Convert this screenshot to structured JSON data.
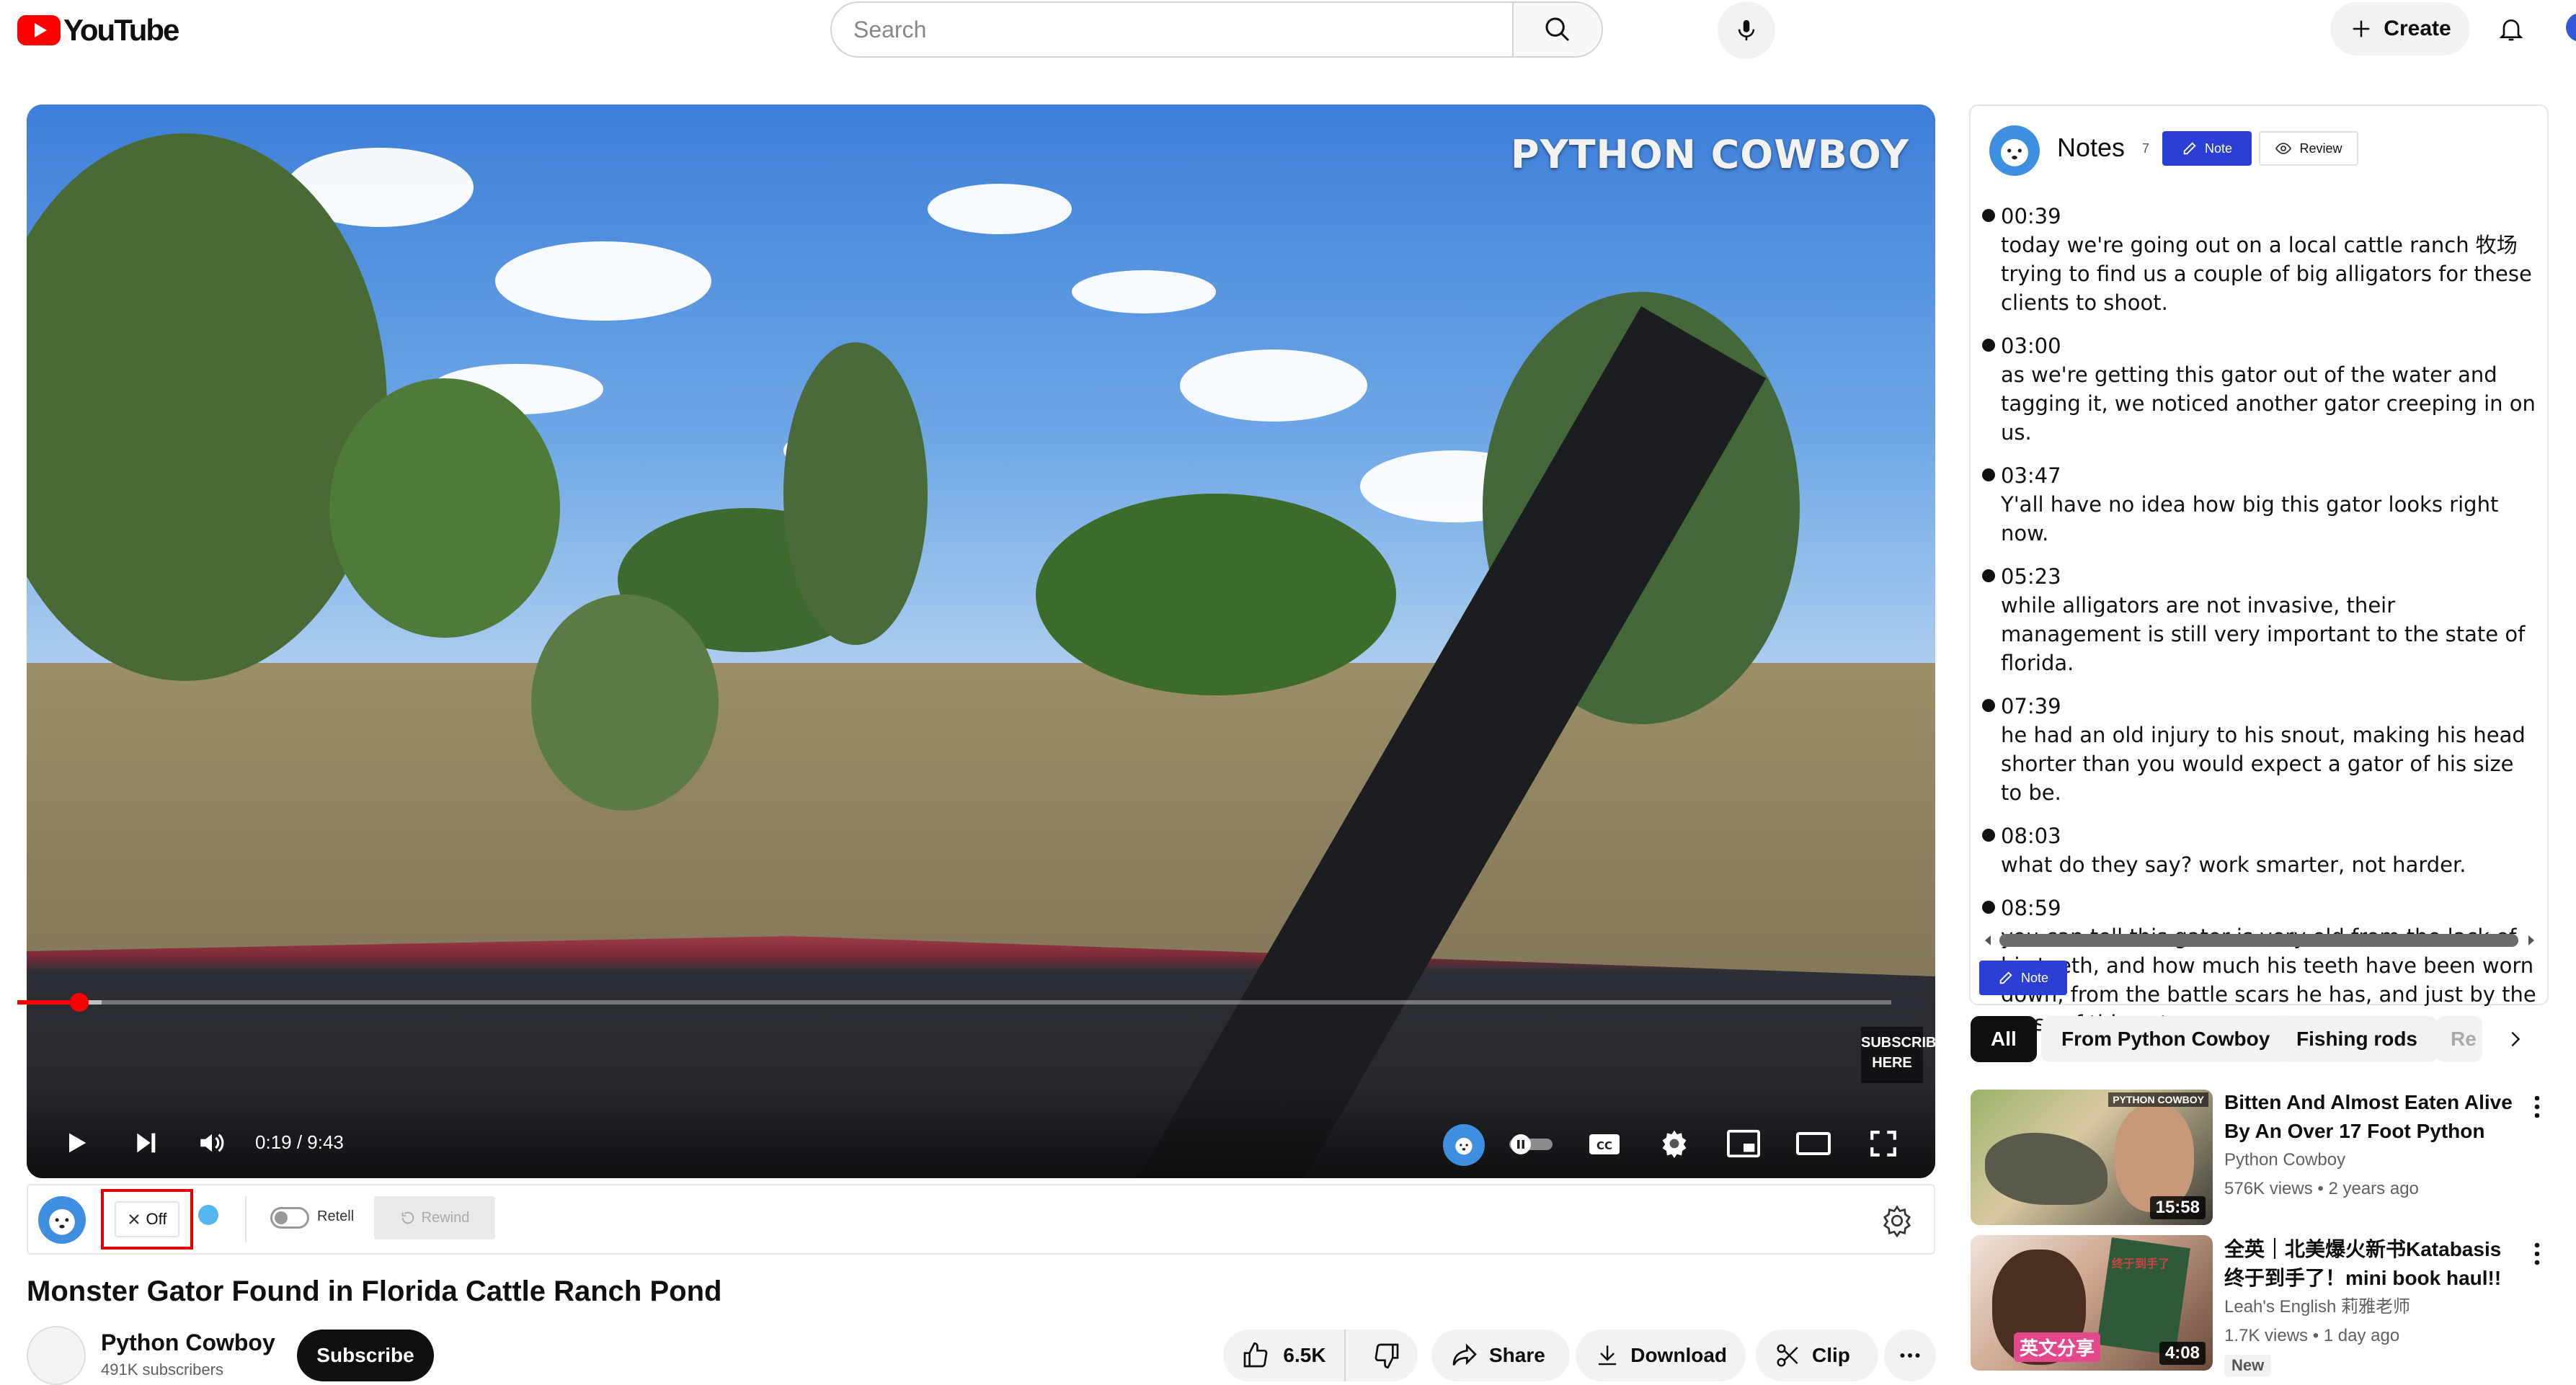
{
  "topbar": {
    "logo_text": "YouTube",
    "search_placeholder": "Search",
    "create_label": "Create"
  },
  "player": {
    "watermark": "PYTHON COWBOY",
    "subscribe_overlay": "SUBSCRIBE HERE",
    "current_time": "0:19",
    "duration": "9:43",
    "time_display": "0:19 / 9:43",
    "progress_fraction": 0.033,
    "buffered_fraction": 0.045
  },
  "toolbar": {
    "off_label": "Off",
    "retell_label": "Retell",
    "rewind_label": "Rewind"
  },
  "video": {
    "title": "Monster Gator Found in Florida Cattle Ranch Pond",
    "channel_name": "Python Cowboy",
    "subscribers": "491K subscribers",
    "subscribe_label": "Subscribe",
    "likes": "6.5K",
    "share_label": "Share",
    "download_label": "Download",
    "clip_label": "Clip"
  },
  "notes": {
    "title": "Notes",
    "count": "7",
    "note_button": "Note",
    "review_button": "Review",
    "items": [
      {
        "time": "00:39",
        "text": "today we're going out on a local cattle ranch 牧场 trying to find us a couple of big alligators for these clients to shoot."
      },
      {
        "time": "03:00",
        "text": "as we're getting this gator out of the water and tagging it, we noticed another gator creeping in on us."
      },
      {
        "time": "03:47",
        "text": "Y'all have no idea how big this gator looks right now."
      },
      {
        "time": "05:23",
        "text": "while alligators are not invasive, their management is still very important to the state of florida."
      },
      {
        "time": "07:39",
        "text": "he had an old injury to his snout, making his head shorter than you would expect a gator of his size to be."
      },
      {
        "time": "08:03",
        "text": "what do they say? work smarter, not harder."
      },
      {
        "time": "08:59",
        "text": "you can tell this gator is very old from the lack of his teeth, and how much his teeth have been worn down, from the battle scars he has, and just by the mass of this gator."
      }
    ],
    "bottom_note_button": "Note"
  },
  "chips": [
    "All",
    "From Python Cowboy",
    "Fishing rods",
    "Re"
  ],
  "recommendations": [
    {
      "title": "Bitten And Almost Eaten Alive By An Over 17 Foot Python",
      "channel": "Python Cowboy",
      "meta": "576K views • 2 years ago",
      "duration": "15:58",
      "thumb_label": "PYTHON COWBOY"
    },
    {
      "title": "全英｜北美爆火新书Katabasis 终于到手了！mini book haul!!",
      "channel": "Leah's English 莉雅老师",
      "meta": "1.7K views • 1 day ago",
      "duration": "4:08",
      "badge": "New",
      "thumb_caption": "英文分享",
      "thumb_tag": "终于到手了"
    }
  ],
  "colors": {
    "youtube_red": "#ff0000",
    "note_blue": "#2b3fd6",
    "highlight_box": "#e00000"
  }
}
